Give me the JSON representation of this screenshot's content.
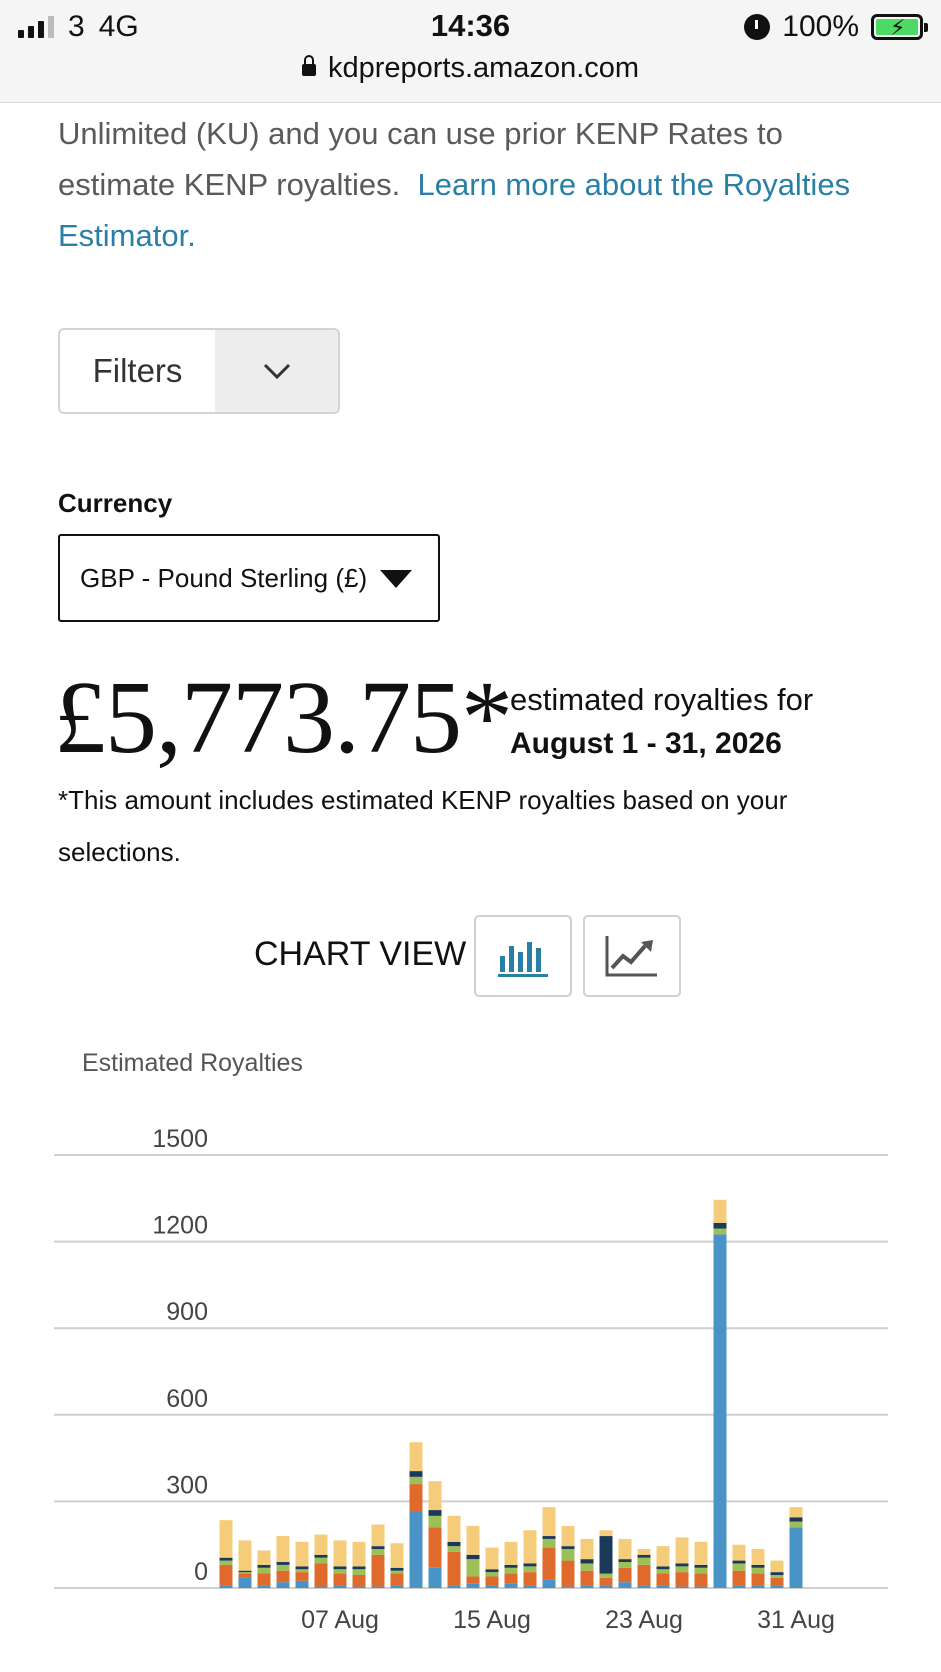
{
  "status_bar": {
    "carrier": "3",
    "network": "4G",
    "time": "14:36",
    "battery": "100%",
    "url": "kdpreports.amazon.com"
  },
  "intro": {
    "text": "Unlimited (KU) and you can use prior KENP Rates to estimate KENP royalties.",
    "link": "Learn more about the Royalties Estimator."
  },
  "filters": {
    "label": "Filters"
  },
  "currency": {
    "label": "Currency",
    "selected": "GBP - Pound Sterling (£)"
  },
  "summary": {
    "amount": "£5,773.75*",
    "estimated_label": "estimated royalties for",
    "date_range": "August 1 - 31, 2026",
    "footnote": "*This amount includes estimated KENP royalties based on your selections."
  },
  "chart_view": {
    "label": "CHART VIEW"
  },
  "icons": {
    "bar_chart": "bar-chart-icon",
    "line_chart": "line-chart-icon",
    "filters": "chevron-down-icon",
    "currency": "caret-down-icon"
  },
  "colors": {
    "link": "#2a7fa6",
    "series_blue": "#4a93c6",
    "series_orange": "#e06a2c",
    "series_green": "#9cbf58",
    "series_gold": "#f4cc7a",
    "series_navy": "#1b3a5a"
  },
  "chart_data": {
    "type": "bar",
    "stacked": true,
    "title": "Estimated Royalties",
    "ylim": [
      0,
      1500
    ],
    "yticks": [
      0,
      300,
      600,
      900,
      1200,
      1500
    ],
    "xtick_labels": [
      "07 Aug",
      "15 Aug",
      "23 Aug",
      "31 Aug"
    ],
    "xtick_days": [
      7,
      15,
      23,
      31
    ],
    "grid": true,
    "x": [
      1,
      2,
      3,
      4,
      5,
      6,
      7,
      8,
      9,
      10,
      11,
      12,
      13,
      14,
      15,
      16,
      17,
      18,
      19,
      20,
      21,
      22,
      23,
      24,
      25,
      26,
      27,
      28,
      29,
      30,
      31
    ],
    "series": [
      {
        "color": "#4a93c6",
        "values": [
          10,
          35,
          10,
          20,
          25,
          5,
          10,
          5,
          5,
          10,
          265,
          70,
          10,
          15,
          10,
          15,
          10,
          30,
          5,
          10,
          10,
          20,
          10,
          10,
          5,
          5,
          1225,
          10,
          10,
          10,
          210
        ]
      },
      {
        "color": "#e06a2c",
        "values": [
          70,
          15,
          40,
          40,
          30,
          80,
          40,
          40,
          110,
          40,
          95,
          140,
          115,
          25,
          30,
          35,
          45,
          110,
          90,
          50,
          25,
          50,
          70,
          40,
          50,
          45,
          0,
          50,
          40,
          25,
          0
        ]
      },
      {
        "color": "#9cbf58",
        "values": [
          15,
          5,
          20,
          20,
          10,
          20,
          15,
          20,
          20,
          10,
          25,
          40,
          20,
          60,
          15,
          20,
          20,
          30,
          40,
          25,
          15,
          20,
          25,
          15,
          20,
          20,
          20,
          25,
          20,
          10,
          20
        ]
      },
      {
        "color": "#1b3a5a",
        "values": [
          10,
          5,
          10,
          10,
          10,
          10,
          10,
          10,
          10,
          10,
          20,
          20,
          15,
          15,
          10,
          10,
          10,
          10,
          10,
          15,
          130,
          10,
          10,
          10,
          10,
          10,
          20,
          10,
          10,
          10,
          15
        ]
      },
      {
        "color": "#f4cc7a",
        "values": [
          130,
          105,
          50,
          90,
          85,
          70,
          90,
          85,
          75,
          85,
          100,
          100,
          90,
          100,
          75,
          80,
          115,
          100,
          70,
          70,
          20,
          70,
          20,
          70,
          90,
          80,
          80,
          55,
          55,
          40,
          35
        ]
      }
    ]
  }
}
